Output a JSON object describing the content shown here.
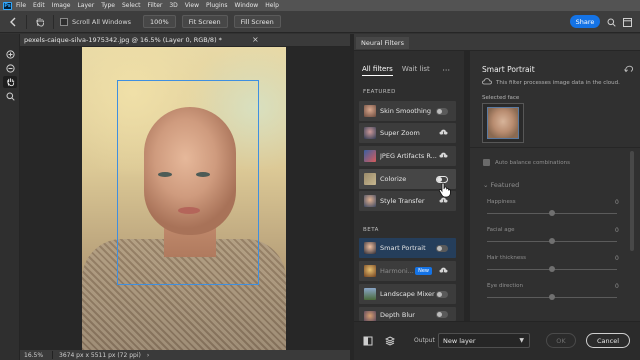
{
  "menubar": {
    "logo": "Ps",
    "items": [
      "File",
      "Edit",
      "Image",
      "Layer",
      "Type",
      "Select",
      "Filter",
      "3D",
      "View",
      "Plugins",
      "Window",
      "Help"
    ]
  },
  "options_bar": {
    "scroll_all_windows": "Scroll All Windows",
    "zoom_100": "100%",
    "fit_screen": "Fit Screen",
    "fill_screen": "Fill Screen",
    "share": "Share"
  },
  "document": {
    "tab_title": "pexels-caique-silva-1975342.jpg @ 16.5% (Layer 0, RGB/8) *",
    "close_glyph": "×"
  },
  "status_bar": {
    "zoom": "16.5%",
    "dimensions": "3674 px x 5511 px (72 ppi)",
    "arrow": "›"
  },
  "neural_filters": {
    "panel_title": "Neural Filters",
    "tabs": [
      "All filters",
      "Wait list"
    ],
    "more": "···",
    "featured_label": "FEATURED",
    "beta_label": "BETA",
    "featured": [
      {
        "name": "Skin Smoothing",
        "control": "toggle"
      },
      {
        "name": "Super Zoom",
        "control": "cloud"
      },
      {
        "name": "JPEG Artifacts R...",
        "control": "cloud"
      },
      {
        "name": "Colorize",
        "control": "toggle"
      },
      {
        "name": "Style Transfer",
        "control": "cloud"
      }
    ],
    "beta": [
      {
        "name": "Smart Portrait",
        "control": "toggle"
      },
      {
        "name": "Harmoni...",
        "control": "new",
        "badge": "New"
      },
      {
        "name": "Landscape Mixer",
        "control": "toggle"
      },
      {
        "name": "Depth Blur",
        "control": "toggle"
      }
    ],
    "selected_filter": "Smart Portrait",
    "hovered_filter": "Colorize"
  },
  "smart_portrait": {
    "title": "Smart Portrait",
    "description": "This filter processes image data in the cloud.",
    "selected_face_label": "Selected face",
    "auto_balance": "Auto balance combinations",
    "featured_section": "Featured",
    "sliders": [
      {
        "label": "Happiness",
        "value": "0",
        "level": 0.5
      },
      {
        "label": "Facial age",
        "value": "0",
        "level": 0.5
      },
      {
        "label": "Hair thickness",
        "value": "0",
        "level": 0.5
      },
      {
        "label": "Eye direction",
        "value": "0",
        "level": 0.5
      }
    ]
  },
  "footer": {
    "output_label": "Output",
    "output_value": "New layer",
    "ok": "OK",
    "cancel": "Cancel"
  },
  "colors": {
    "accent": "#1473e6",
    "selection_box": "#3f8fe0",
    "selected_row": "#253e5b"
  }
}
